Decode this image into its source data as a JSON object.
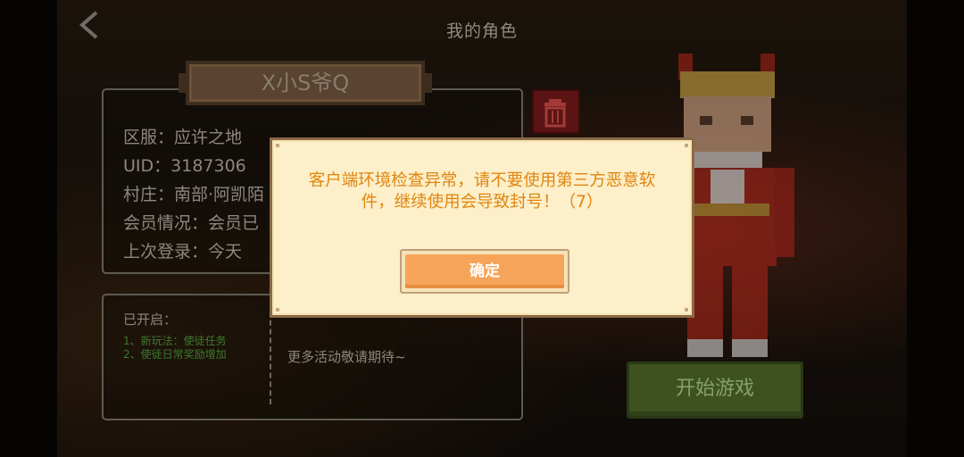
{
  "header": {
    "title": "我的角色"
  },
  "role": {
    "name": "X小S爷Q",
    "info": [
      "区服：应许之地",
      "UID：3187306",
      "村庄：南部·阿凯陌",
      "会员情况：会员已",
      "上次登录：今天"
    ]
  },
  "events": {
    "title": "已开启：",
    "items": [
      "1、新玩法：使徒任务",
      "2、使徒日常奖励增加"
    ],
    "more": "更多活动敬请期待~"
  },
  "buttons": {
    "start": "开始游戏"
  },
  "dialog": {
    "message": "客户端环境检查异常，请不要使用第三方恶意软件，继续使用会导致封号！（7）",
    "confirm": "确定"
  },
  "icons": {
    "back": "chevron-left-icon",
    "delete": "trash-icon"
  },
  "colors": {
    "dialog_text": "#e2850f",
    "confirm_button": "#f6a45a",
    "delete_button": "#5b1413",
    "start_button": "#3e5220"
  }
}
